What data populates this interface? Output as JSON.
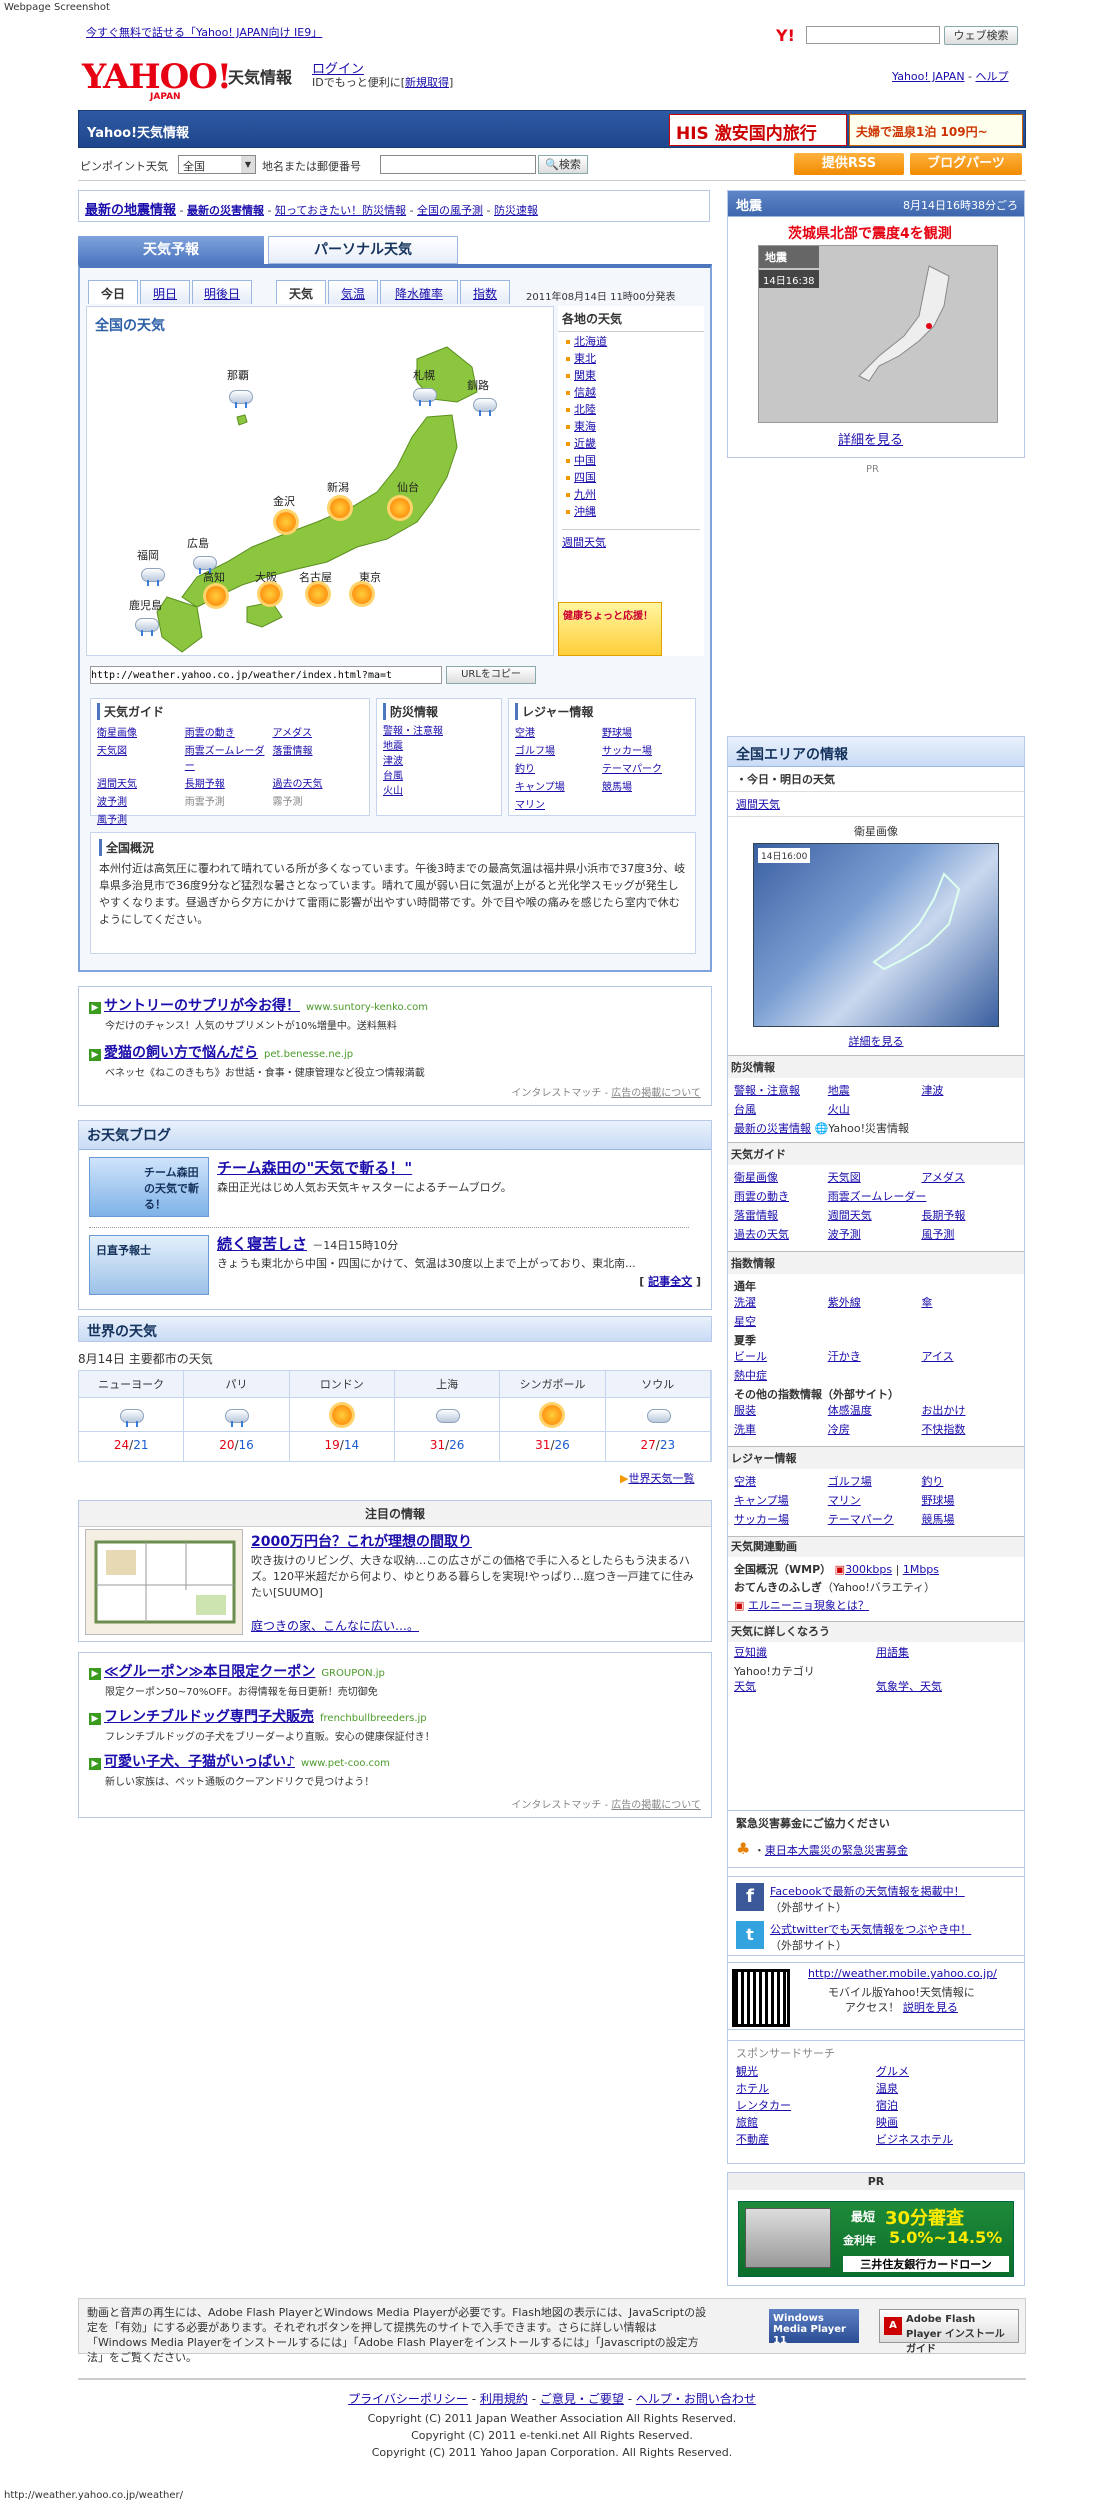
{
  "page": {
    "screenshot_label": "Webpage Screenshot",
    "status_url": "http://weather.yahoo.co.jp/weather/"
  },
  "top": {
    "ie_promo": "今すぐ無料で話せる「Yahoo! JAPAN向け IE9」",
    "search_btn": "ウェブ検索",
    "search_value": "",
    "login": "ログイン",
    "login_sub": "IDでもっと便利に[",
    "register": "新規取得",
    "register_end": "]",
    "links": [
      "Yahoo! JAPAN",
      "ヘルプ"
    ],
    "site_name": "天気情報",
    "logo": "YAHOO! JAPAN"
  },
  "bar": {
    "title": "Yahoo!天気情報",
    "ad1": "HIS 激安国内旅行",
    "ad2": "夫婦で温泉1泊 109円~"
  },
  "pinpoint": {
    "label": "ピンポイント天気",
    "select": "全国",
    "label2": "地名または郵便番号",
    "search": "検索",
    "rss": "提供RSS",
    "parts": "ブログパーツ"
  },
  "quake_links": {
    "main": "最新の地震情報",
    "items": [
      "最新の災害情報",
      "知っておきたい！防災情報",
      "全国の風予測",
      "防災速報"
    ]
  },
  "quake": {
    "title": "地震",
    "time": "8月14日16時38分ごろ",
    "headline": "茨城県北部で震度4を観測",
    "map_label": "地震",
    "map_time": "14日16:38",
    "detail": "詳細を見る",
    "pr": "PR"
  },
  "main_tabs": {
    "forecast": "天気予報",
    "personal": "パーソナル天気"
  },
  "day_tabs": [
    "今日",
    "明日",
    "明後日"
  ],
  "type_tabs": [
    "天気",
    "気温",
    "降水確率",
    "指数"
  ],
  "issued": "2011年08月14日 11時00分発表",
  "map": {
    "title": "全国の天気",
    "cities": [
      "那覇",
      "札幌",
      "釧路",
      "金沢",
      "新潟",
      "仙台",
      "広島",
      "福岡",
      "大阪",
      "名古屋",
      "東京",
      "高知",
      "鹿児島"
    ],
    "weekly": "週間天気",
    "ad": "健康ちょっと応援！"
  },
  "regions": {
    "title": "各地の天気",
    "items": [
      "北海道",
      "東北",
      "関東",
      "信越",
      "北陸",
      "東海",
      "近畿",
      "中国",
      "四国",
      "九州",
      "沖縄"
    ]
  },
  "url_copy": {
    "value": "http://weather.yahoo.co.jp/weather/index.html?ma=t",
    "btn": "URLをコピー"
  },
  "guide": {
    "title": "天気ガイド",
    "items": [
      "衛星画像",
      "雨雲の動き",
      "アメダス",
      "天気図",
      "雨雲ズームレーダー",
      "落雷情報",
      "週間天気",
      "長期予報",
      "過去の天気",
      "波予測",
      "雨雲予測",
      "霧予測",
      "風予測"
    ]
  },
  "bousai": {
    "title": "防災情報",
    "items": [
      "警報・注意報",
      "地震",
      "津波",
      "台風",
      "火山"
    ]
  },
  "leisure": {
    "title": "レジャー情報",
    "items": [
      "空港",
      "野球場",
      "ゴルフ場",
      "サッカー場",
      "釣り",
      "テーマパーク",
      "キャンプ場",
      "競馬場",
      "マリン"
    ]
  },
  "overview": {
    "title": "全国概況",
    "text": "本州付近は高気圧に覆われて晴れている所が多くなっています。午後3時までの最高気温は福井県小浜市で37度3分、岐阜県多治見市で36度9分など猛烈な暑さとなっています。晴れて風が弱い日に気温が上がると光化学スモッグが発生しやすくなります。昼過ぎから夕方にかけて雷雨に影響が出やすい時間帯です。外で目や喉の痛みを感じたら室内で休むようにしてください。"
  },
  "ads1": [
    {
      "title": "サントリーのサプリが今お得！",
      "url": "www.suntory-kenko.com",
      "desc": "今だけのチャンス！人気のサプリメントが10%増量中。送料無料"
    },
    {
      "title": "愛猫の飼い方で悩んだら",
      "url": "pet.benesse.ne.jp",
      "desc": "ベネッセ《ねこのきもち》お世話・食事・健康管理など役立つ情報満載"
    }
  ],
  "ads_footer": [
    "インタレストマッチ",
    "広告の掲載について"
  ],
  "blog": {
    "title": "お天気ブログ",
    "items": [
      {
        "title": "チーム森田の\"天気で斬る！\"",
        "desc": "森田正光はじめ人気お天気キャスターによるチームブログ。",
        "img": "チーム森田の天気で斬る！"
      },
      {
        "title": "続く寝苦しさ",
        "time": "－14日15時10分",
        "desc": "きょうも東北から中国・四国にかけて、気温は30度以上まで上がっており、東北南...",
        "more": "記事全文",
        "img": "日直予報士"
      }
    ]
  },
  "world": {
    "title": "世界の天気",
    "date": "8月14日 主要都市の天気",
    "cities": [
      {
        "name": "ニューヨーク",
        "hi": "24",
        "lo": "21",
        "w": "rain"
      },
      {
        "name": "パリ",
        "hi": "20",
        "lo": "16",
        "w": "rain"
      },
      {
        "name": "ロンドン",
        "hi": "19",
        "lo": "14",
        "w": "sun"
      },
      {
        "name": "上海",
        "hi": "31",
        "lo": "26",
        "w": "cloud"
      },
      {
        "name": "シンガポール",
        "hi": "31",
        "lo": "26",
        "w": "sun"
      },
      {
        "name": "ソウル",
        "hi": "27",
        "lo": "23",
        "w": "cloud"
      }
    ],
    "more": "世界天気一覧"
  },
  "notice": {
    "title": "注目の情報",
    "headline": "2000万円台？これが理想の間取り",
    "desc": "吹き抜けのリビング、大きな収納…この広さがこの価格で手に入るとしたらもう決まるハズ。120平米超だから何より、ゆとりある暮らしを実現!やっぱり…庭つき一戸建てに住みたい[SUUMO]",
    "link": "庭つきの家、こんなに広い…。"
  },
  "ads2": [
    {
      "title": "≪グルーポン≫本日限定クーポン",
      "url": "GROUPON.jp",
      "desc": "限定クーポン50~70%OFF。お得情報を毎日更新！売切御免"
    },
    {
      "title": "フレンチブルドッグ専門子犬販売",
      "url": "frenchbullbreeders.jp",
      "desc": "フレンチブルドッグの子犬をブリーダーより直販。安心の健康保証付き！"
    },
    {
      "title": "可愛い子犬、子猫がいっぱい♪",
      "url": "www.pet-coo.com",
      "desc": "新しい家族は、ペット通販のクーアンドリクで見つけよう！"
    }
  ],
  "side": {
    "area_title": "全国エリアの情報",
    "today": "今日・明日の天気",
    "weekly": "週間天気",
    "sat_title": "衛星画像",
    "sat_time": "14日16:00",
    "sat_more": "詳細を見る",
    "bousai": {
      "title": "防災情報",
      "items": [
        "警報・注意報",
        "地震",
        "津波",
        "台風",
        "火山",
        "最新の災害情報",
        "Yahoo!災害情報"
      ]
    },
    "guide": {
      "title": "天気ガイド",
      "items": [
        "衛星画像",
        "天気図",
        "アメダス",
        "雨雲の動き",
        "雨雲ズームレーダー",
        "落雷情報",
        "週間天気",
        "長期予報",
        "過去の天気",
        "波予測",
        "風予測"
      ]
    },
    "index": {
      "title": "指数情報",
      "summer_all": "通年",
      "items1": [
        "洗濯",
        "紫外線",
        "傘",
        "星空"
      ],
      "summer": "夏季",
      "items2": [
        "ビール",
        "汗かき",
        "アイス",
        "熱中症"
      ],
      "other": "その他の指数情報（外部サイト）",
      "items3": [
        "服装",
        "体感温度",
        "お出かけ",
        "洗車",
        "冷房",
        "不快指数"
      ]
    },
    "leisure": {
      "title": "レジャー情報",
      "items": [
        "空港",
        "ゴルフ場",
        "釣り",
        "キャンプ場",
        "マリン",
        "野球場",
        "サッカー場",
        "テーマパーク",
        "競馬場"
      ]
    },
    "video": {
      "title": "天気関連動画",
      "l1": "全国概況（WMP）",
      "r1": "300kbps",
      "r2": "1Mbps",
      "l2": "おてんきのふしぎ",
      "l2b": "（Yahoo!バラエティ）",
      "l3": "エルニーニョ現象とは？"
    },
    "learn": {
      "title": "天気に詳しくなろう",
      "items": [
        "豆知識",
        "用語集",
        "Yahoo!カテゴリ",
        "天気",
        "気象学、天気"
      ]
    },
    "donate": {
      "title": "緊急災害募金にご協力ください",
      "link": "東日本大震災の緊急災害募金"
    },
    "social": [
      {
        "text": "Facebookで最新の天気情報を掲載中！",
        "sub": "（外部サイト）"
      },
      {
        "text": "公式twitterでも天気情報をつぶやき中！",
        "sub": "（外部サイト）"
      }
    ],
    "mobile": {
      "url": "http://weather.mobile.yahoo.co.jp/",
      "text": "モバイル版Yahoo!天気情報に",
      "text2": "アクセス！",
      "howto": "説明を見る"
    },
    "sponsor": {
      "title": "スポンサードサーチ",
      "items": [
        "観光",
        "グルメ",
        "ホテル",
        "温泉",
        "レンタカー",
        "宿泊",
        "旅館",
        "映画",
        "不動産",
        "ビジネスホテル"
      ]
    },
    "pr": {
      "title": "PR",
      "l1": "最短",
      "l2": "30分審査",
      "l3": "金利年",
      "l4": "5.0%~14.5%",
      "l5": "三井住友銀行カードローン"
    }
  },
  "flash": {
    "text": "動画と音声の再生には、Adobe Flash PlayerとWindows Media Playerが必要です。Flash地図の表示には、JavaScriptの設定を「有効」にする必要があります。それぞれボタンを押して提携先のサイトで入手できます。さらに詳しい情報は「Windows Media Playerをインストールするには」「Adobe Flash Playerをインストールするには」「Javascriptの設定方法」をご覧ください。",
    "wmp": "Windows Media Player 11",
    "adobe": "Adobe Flash Player インストールガイド"
  },
  "footer": {
    "links": [
      "プライバシーポリシー",
      "利用規約",
      "ご意見・ご要望",
      "ヘルプ・お問い合わせ"
    ],
    "c1": "Copyright (C) 2011 Japan Weather Association All Rights Reserved.",
    "c2": "Copyright (C) 2011 e-tenki.net All Rights Reserved.",
    "c3": "Copyright (C) 2011 Yahoo Japan Corporation. All Rights Reserved."
  },
  "colors": {
    "link": "#1a0dab",
    "accent": "#3d66ad",
    "orange": "#f39800",
    "red": "#e60012"
  }
}
